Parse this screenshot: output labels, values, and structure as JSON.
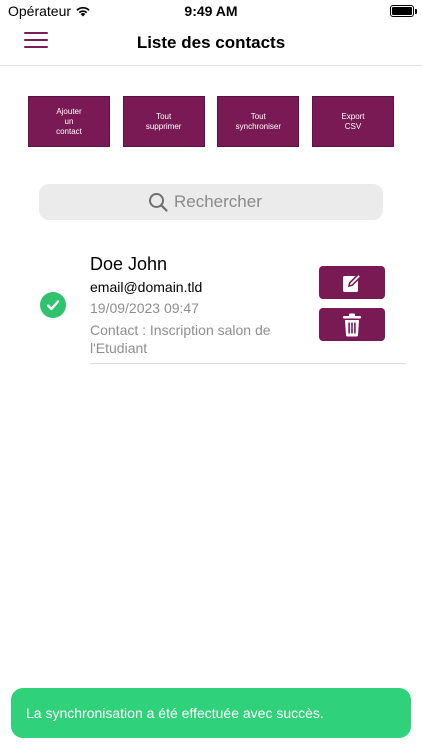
{
  "status_bar": {
    "carrier": "Opérateur",
    "time": "9:49 AM"
  },
  "nav": {
    "title": "Liste des contacts"
  },
  "actions": [
    {
      "label": "Ajouter\nun\ncontact"
    },
    {
      "label": "Tout\nsupprimer"
    },
    {
      "label": "Tout\nsynchroniser"
    },
    {
      "label": "Export\nCSV"
    }
  ],
  "search": {
    "placeholder": "Rechercher"
  },
  "contacts": [
    {
      "name": "Doe John",
      "email": "email@domain.tld",
      "date": "19/09/2023 09:47",
      "note": "Contact : Inscription salon de l'Etudiant",
      "synced": true
    }
  ],
  "toast": {
    "message": "La synchronisation a été effectuée avec succès."
  },
  "colors": {
    "accent": "#7a1a54",
    "success": "#2fc26f",
    "toast": "#2fd27a"
  }
}
